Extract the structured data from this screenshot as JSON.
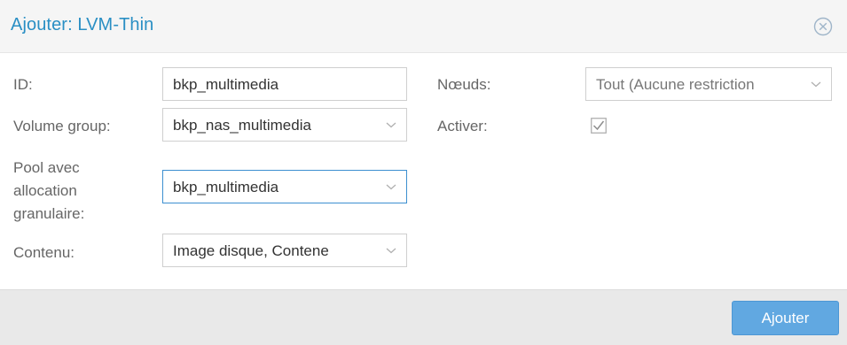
{
  "dialog": {
    "title": "Ajouter: LVM-Thin",
    "close_icon": "close-circle-icon"
  },
  "form": {
    "id": {
      "label": "ID:",
      "value": "bkp_multimedia"
    },
    "volume_group": {
      "label": "Volume group:",
      "value": "bkp_nas_multimedia"
    },
    "pool": {
      "label_line1": "Pool avec",
      "label_line2": "allocation",
      "label_line3": "granulaire:",
      "value": "bkp_multimedia"
    },
    "contenu": {
      "label": "Contenu:",
      "value": "Image disque, Contene"
    },
    "noeuds": {
      "label": "Nœuds:",
      "value": "Tout (Aucune restriction"
    },
    "activer": {
      "label": "Activer:",
      "checked": true
    }
  },
  "footer": {
    "add_label": "Ajouter"
  },
  "colors": {
    "title": "#2a8fc4",
    "focus_border": "#3c8fd0",
    "button_bg": "#61a8e1"
  }
}
